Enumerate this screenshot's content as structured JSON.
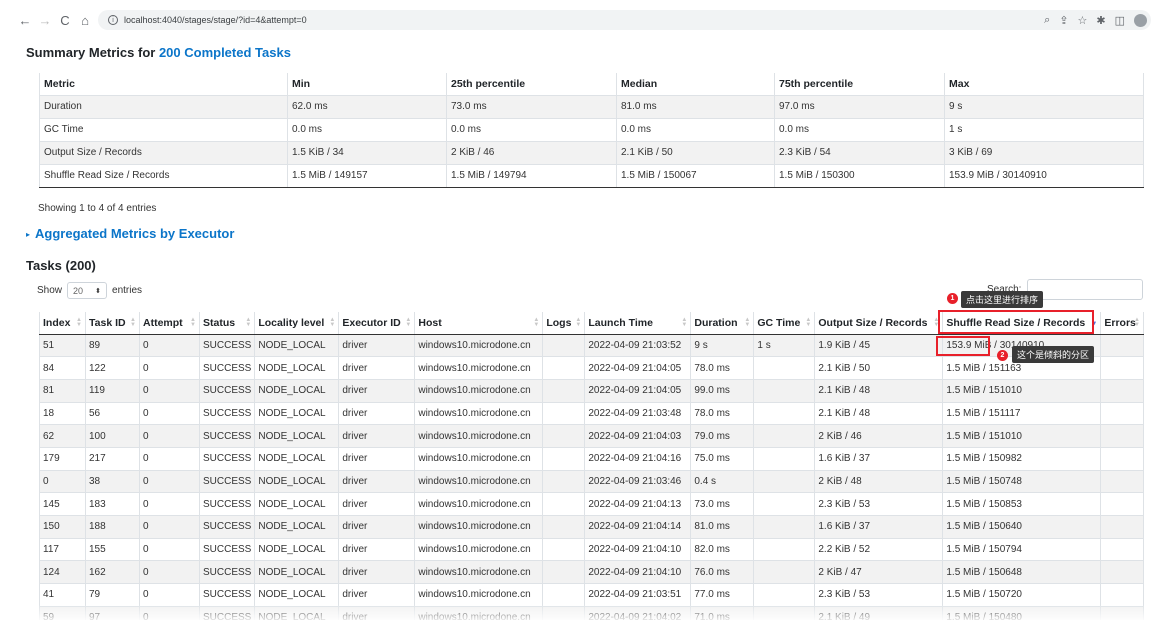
{
  "browser": {
    "url": "localhost:4040/stages/stage/?id=4&attempt=0",
    "back_icon": "←",
    "forward_icon": "→",
    "reload_icon": "C",
    "home_icon": "⌂",
    "info_icon": "i",
    "right_icons": [
      "⌕",
      "⇪",
      "☆",
      "✱",
      "◫"
    ]
  },
  "summary": {
    "title_prefix": "Summary Metrics for ",
    "title_link": "200 Completed Tasks",
    "headers": [
      "Metric",
      "Min",
      "25th percentile",
      "Median",
      "75th percentile",
      "Max"
    ],
    "rows": [
      [
        "Duration",
        "62.0 ms",
        "73.0 ms",
        "81.0 ms",
        "97.0 ms",
        "9 s"
      ],
      [
        "GC Time",
        "0.0 ms",
        "0.0 ms",
        "0.0 ms",
        "0.0 ms",
        "1 s"
      ],
      [
        "Output Size / Records",
        "1.5 KiB / 34",
        "2 KiB / 46",
        "2.1 KiB / 50",
        "2.3 KiB / 54",
        "3 KiB / 69"
      ],
      [
        "Shuffle Read Size / Records",
        "1.5 MiB / 149157",
        "1.5 MiB / 149794",
        "1.5 MiB / 150067",
        "1.5 MiB / 150300",
        "153.9 MiB / 30140910"
      ]
    ],
    "entries_info": "Showing 1 to 4 of 4 entries"
  },
  "aggregated": {
    "label": "Aggregated Metrics by Executor",
    "toggle_icon": "▸"
  },
  "tasks": {
    "title": "Tasks (200)",
    "show_label": "Show",
    "show_value": "20",
    "entries_label": "entries",
    "search_label": "Search:",
    "headers": [
      "Index",
      "Task ID",
      "Attempt",
      "Status",
      "Locality level",
      "Executor ID",
      "Host",
      "Logs",
      "Launch Time",
      "Duration",
      "GC Time",
      "Output Size / Records",
      "Shuffle Read Size / Records",
      "Errors"
    ],
    "rows": [
      [
        "51",
        "89",
        "0",
        "SUCCESS",
        "NODE_LOCAL",
        "driver",
        "windows10.microdone.cn",
        "",
        "2022-04-09 21:03:52",
        "9 s",
        "1 s",
        "1.9 KiB / 45",
        "153.9 MiB / 30140910",
        ""
      ],
      [
        "84",
        "122",
        "0",
        "SUCCESS",
        "NODE_LOCAL",
        "driver",
        "windows10.microdone.cn",
        "",
        "2022-04-09 21:04:05",
        "78.0 ms",
        "",
        "2.1 KiB / 50",
        "1.5 MiB / 151163",
        ""
      ],
      [
        "81",
        "119",
        "0",
        "SUCCESS",
        "NODE_LOCAL",
        "driver",
        "windows10.microdone.cn",
        "",
        "2022-04-09 21:04:05",
        "99.0 ms",
        "",
        "2.1 KiB / 48",
        "1.5 MiB / 151010",
        ""
      ],
      [
        "18",
        "56",
        "0",
        "SUCCESS",
        "NODE_LOCAL",
        "driver",
        "windows10.microdone.cn",
        "",
        "2022-04-09 21:03:48",
        "78.0 ms",
        "",
        "2.1 KiB / 48",
        "1.5 MiB / 151117",
        ""
      ],
      [
        "62",
        "100",
        "0",
        "SUCCESS",
        "NODE_LOCAL",
        "driver",
        "windows10.microdone.cn",
        "",
        "2022-04-09 21:04:03",
        "79.0 ms",
        "",
        "2 KiB / 46",
        "1.5 MiB / 151010",
        ""
      ],
      [
        "179",
        "217",
        "0",
        "SUCCESS",
        "NODE_LOCAL",
        "driver",
        "windows10.microdone.cn",
        "",
        "2022-04-09 21:04:16",
        "75.0 ms",
        "",
        "1.6 KiB / 37",
        "1.5 MiB / 150982",
        ""
      ],
      [
        "0",
        "38",
        "0",
        "SUCCESS",
        "NODE_LOCAL",
        "driver",
        "windows10.microdone.cn",
        "",
        "2022-04-09 21:03:46",
        "0.4 s",
        "",
        "2 KiB / 48",
        "1.5 MiB / 150748",
        ""
      ],
      [
        "145",
        "183",
        "0",
        "SUCCESS",
        "NODE_LOCAL",
        "driver",
        "windows10.microdone.cn",
        "",
        "2022-04-09 21:04:13",
        "73.0 ms",
        "",
        "2.3 KiB / 53",
        "1.5 MiB / 150853",
        ""
      ],
      [
        "150",
        "188",
        "0",
        "SUCCESS",
        "NODE_LOCAL",
        "driver",
        "windows10.microdone.cn",
        "",
        "2022-04-09 21:04:14",
        "81.0 ms",
        "",
        "1.6 KiB / 37",
        "1.5 MiB / 150640",
        ""
      ],
      [
        "117",
        "155",
        "0",
        "SUCCESS",
        "NODE_LOCAL",
        "driver",
        "windows10.microdone.cn",
        "",
        "2022-04-09 21:04:10",
        "82.0 ms",
        "",
        "2.2 KiB / 52",
        "1.5 MiB / 150794",
        ""
      ],
      [
        "124",
        "162",
        "0",
        "SUCCESS",
        "NODE_LOCAL",
        "driver",
        "windows10.microdone.cn",
        "",
        "2022-04-09 21:04:10",
        "76.0 ms",
        "",
        "2 KiB / 47",
        "1.5 MiB / 150648",
        ""
      ],
      [
        "41",
        "79",
        "0",
        "SUCCESS",
        "NODE_LOCAL",
        "driver",
        "windows10.microdone.cn",
        "",
        "2022-04-09 21:03:51",
        "77.0 ms",
        "",
        "2.3 KiB / 53",
        "1.5 MiB / 150720",
        ""
      ],
      [
        "59",
        "97",
        "0",
        "SUCCESS",
        "NODE_LOCAL",
        "driver",
        "windows10.microdone.cn",
        "",
        "2022-04-09 21:04:02",
        "71.0 ms",
        "",
        "2.1 KiB / 49",
        "1.5 MiB / 150480",
        ""
      ]
    ],
    "sort_icon": "▲▼",
    "sort_active_icon": "▼"
  },
  "annotations": {
    "step1_number": "1",
    "step1_text": "点击这里进行排序",
    "step2_number": "2",
    "step2_text": "这个是倾斜的分区"
  },
  "colors": {
    "link": "#0b75c9",
    "annotation_red": "#e8202a"
  }
}
